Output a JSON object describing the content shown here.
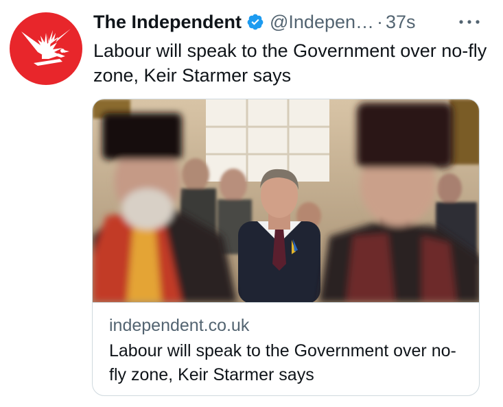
{
  "tweet": {
    "author_name": "The Independent",
    "handle": "@Indepen…",
    "separator": "·",
    "timestamp": "37s",
    "text": "Labour will speak to the Government over no-fly zone, Keir Starmer says",
    "icons": {
      "avatar": "eagle-logo",
      "verified": "verified-badge-icon",
      "more": "more-options-icon"
    },
    "colors": {
      "avatar_bg": "#e8262b",
      "verified": "#1d9bf0",
      "secondary_text": "#536471",
      "primary_text": "#0f1419",
      "border": "#cfd9de"
    }
  },
  "card": {
    "domain": "independent.co.uk",
    "title": "Labour will speak to the Government over no-fly zone, Keir Starmer says"
  }
}
